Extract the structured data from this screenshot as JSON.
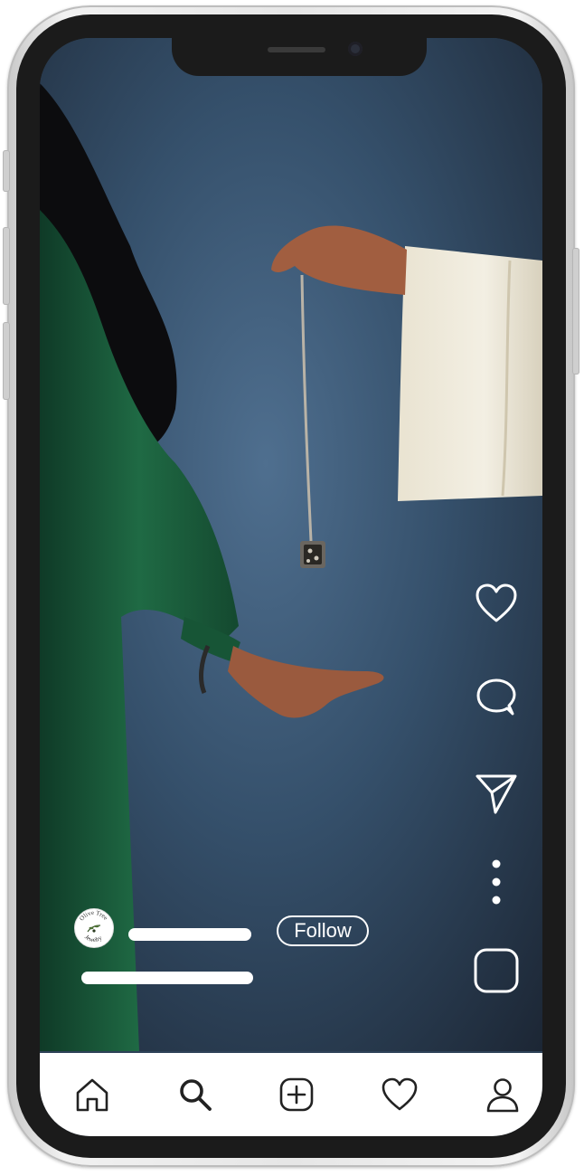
{
  "post": {
    "account_avatar": "Olive Tree Jewelry",
    "follow_label": "Follow"
  },
  "actions": {
    "like_icon": "heart-icon",
    "comment_icon": "comment-bubble-icon",
    "share_icon": "paper-plane-icon",
    "more_icon": "more-vertical-icon",
    "audio_icon": "audio-square-icon"
  },
  "tabbar": {
    "items": [
      "home-icon",
      "search-icon",
      "create-icon",
      "activity-heart-icon",
      "profile-icon"
    ]
  },
  "colors": {
    "backdrop": "#2e4258",
    "tabbar": "#ffffff",
    "icon_overlay": "#ffffff",
    "icon_tab": "#222222"
  }
}
